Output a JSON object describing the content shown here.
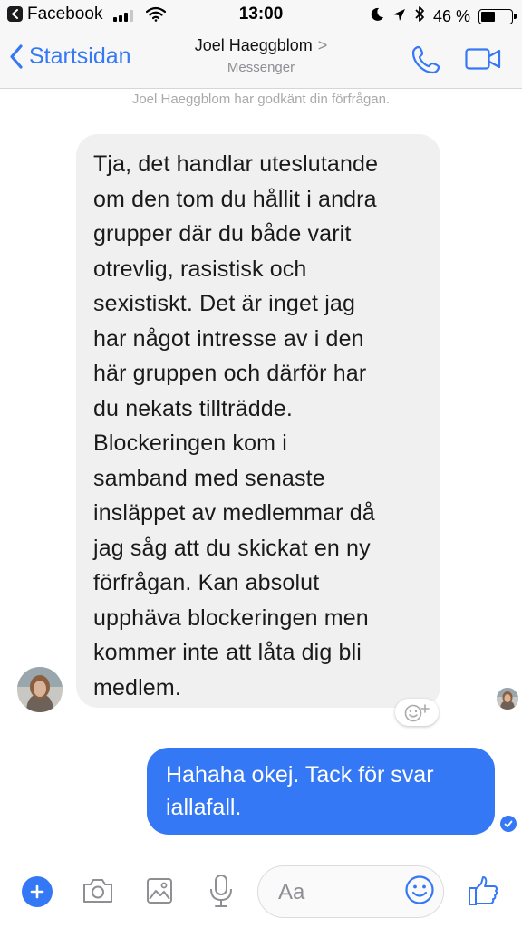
{
  "status_bar": {
    "back_app": "Facebook",
    "time": "13:00",
    "battery": "46 %",
    "battery_level": 0.46
  },
  "nav": {
    "back_label": "Startsidan",
    "title": "Joel Haeggblom",
    "title_chevron": ">",
    "subtitle": "Messenger",
    "icons": [
      "phone-icon",
      "video-camera-icon"
    ]
  },
  "conversation": {
    "system_note": "Joel Haeggblom har godkänt din förfrågan.",
    "incoming": {
      "lines": [
        "Tja, det handlar uteslutande",
        "om den tom du hållit i andra",
        "grupper där du både varit",
        "otrevlig, rasistisk och",
        "sexistiskt. Det är inget jag",
        "har något intresse av i den",
        "här gruppen och därför har",
        "du nekats tillträdde.",
        "Blockeringen kom i",
        "samband med senaste",
        "insläppet av medlemmar då",
        "jag såg att du skickat en ny",
        "förfrågan. Kan absolut",
        "upphäva blockeringen men",
        "kommer inte att låta dig bli",
        "medlem."
      ]
    },
    "outgoing": {
      "lines": [
        "Hahaha okej. Tack för svar",
        "iallafall."
      ]
    }
  },
  "composer": {
    "placeholder": "Aa",
    "icons": [
      "plus-icon",
      "camera-icon",
      "image-icon",
      "microphone-icon",
      "smiley-icon",
      "thumbs-up-icon"
    ]
  },
  "colors": {
    "accent": "#3478f6",
    "incoming_bubble": "#f0f0f0",
    "bar_background": "#f7f7f7",
    "muted_text": "#8e8e93"
  }
}
